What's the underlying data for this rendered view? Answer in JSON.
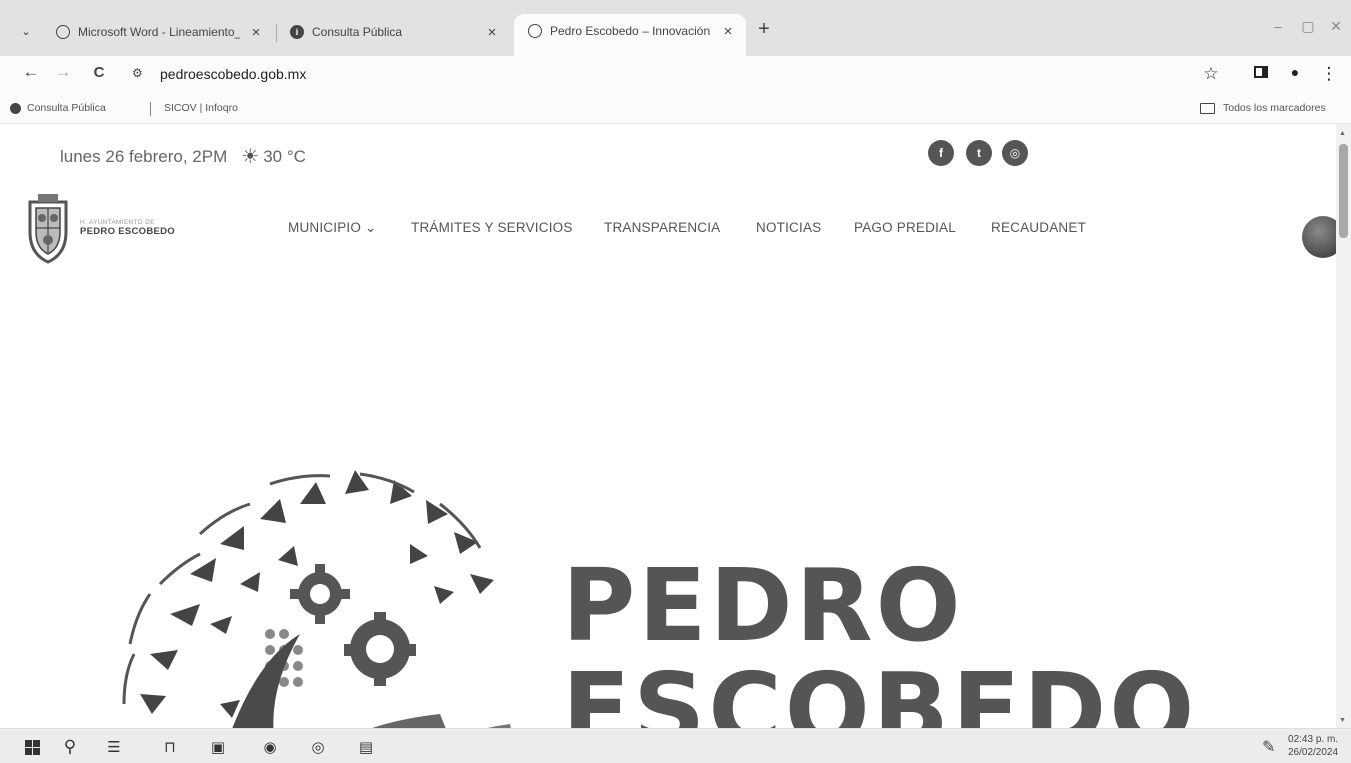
{
  "browser": {
    "tabs": [
      {
        "title": "Microsoft Word - Lineamiento_",
        "close": "×"
      },
      {
        "title": "Consulta Pública",
        "close": "×"
      },
      {
        "title": "Pedro Escobedo – Innovación y",
        "close": "×"
      }
    ],
    "new_tab": "+",
    "window_controls": {
      "minimize": "–",
      "maximize": "▢",
      "close": "✕"
    },
    "nav": {
      "back": "←",
      "forward": "→",
      "reload": "C"
    },
    "url": "pedroescobedo.gob.mx",
    "bookmarks": [
      "Consulta Pública",
      "SICOV | Infoqro"
    ],
    "all_bookmarks": "Todos los marcadores",
    "icons": [
      "tab-search-icon",
      "globe-icon",
      "info-icon",
      "star-icon",
      "side-panel-icon",
      "profile-icon",
      "kebab-menu-icon",
      "folder-icon"
    ]
  },
  "page": {
    "date_time": "lunes 26 febrero, 2PM",
    "temperature": "30 °C",
    "social": [
      "facebook-icon",
      "twitter-icon",
      "instagram-icon"
    ],
    "logo": {
      "sup": "H. AYUNTAMIENTO DE",
      "name": "PEDRO ESCOBEDO"
    },
    "menu": [
      "MUNICIPIO ⌄",
      "TRÁMITES Y SERVICIOS",
      "TRANSPARENCIA",
      "NOTICIAS",
      "PAGO PREDIAL",
      "RECAUDANET"
    ],
    "hero": {
      "line1": "PEDRO",
      "line2": "ESCOBEDO"
    }
  },
  "taskbar": {
    "icons": [
      "windows-start-icon",
      "search-icon",
      "task-view-icon",
      "store-icon",
      "app-icon",
      "chrome-icon",
      "chrome-alt-icon",
      "word-icon"
    ],
    "time": "02:43 p. m.",
    "date": "26/02/2024"
  },
  "colors": {
    "chrome_bg": "#e2e2e2",
    "page_bg": "#ffffff",
    "text_gray": "#555555"
  }
}
